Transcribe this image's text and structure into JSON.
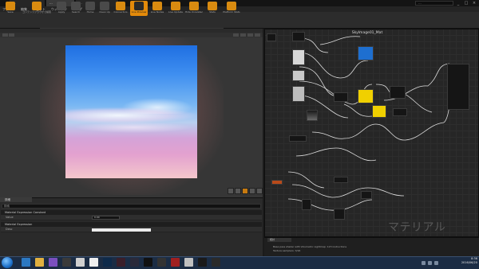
{
  "title_bar": {
    "tabs": [
      "...",
      "...",
      "..."
    ],
    "search_placeholder": "..."
  },
  "menu": [
    "ファイル",
    "編集",
    "アセット",
    "ウィンドウ",
    "ヘルプ"
  ],
  "toolbar": {
    "buttons": [
      {
        "label": "Save",
        "icon": "save-icon",
        "state": "on"
      },
      {
        "label": "コンテンツブラウザで検索",
        "icon": "browse-icon",
        "state": "on"
      },
      {
        "label": "Apply",
        "icon": "apply-icon",
        "state": "off"
      },
      {
        "label": "Search",
        "icon": "search-icon",
        "state": "off"
      },
      {
        "label": "Home",
        "icon": "home-icon",
        "state": "off"
      },
      {
        "label": "Clean Up",
        "icon": "cleanup-icon",
        "state": "off"
      },
      {
        "label": "Connectors",
        "icon": "connectors-icon",
        "state": "on"
      },
      {
        "label": "Live Preview",
        "icon": "live-preview-icon",
        "state": "hl"
      },
      {
        "label": "Live Nodes",
        "icon": "live-nodes-icon",
        "state": "on"
      },
      {
        "label": "Live Update",
        "icon": "live-update-icon",
        "state": "on"
      },
      {
        "label": "Hide Unrelated",
        "icon": "hide-unrelated-icon",
        "state": "on"
      },
      {
        "label": "Stats",
        "icon": "stats-icon",
        "state": "on"
      },
      {
        "label": "Platform Stats",
        "icon": "platform-stats-icon",
        "state": "on"
      }
    ],
    "accent_color": "#e38a0a"
  },
  "details": {
    "tab_label": "詳細",
    "search_placeholder": "検索",
    "section1": "Material Expression Constant",
    "row1_label": "Value",
    "row1_value": "0.00",
    "section2": "Material Expression",
    "row2_label": "Desc"
  },
  "graph": {
    "title": "SkyImage01_Mat",
    "watermark": "マテリアル"
  },
  "output_log": {
    "tab_label": "統計",
    "lines": [
      "Base pass shader with Volumetric Lightmap: 123 instructions",
      "Texture samplers: 3/16"
    ]
  },
  "taskbar": {
    "time": "8:36",
    "date": "2016/06/20"
  }
}
